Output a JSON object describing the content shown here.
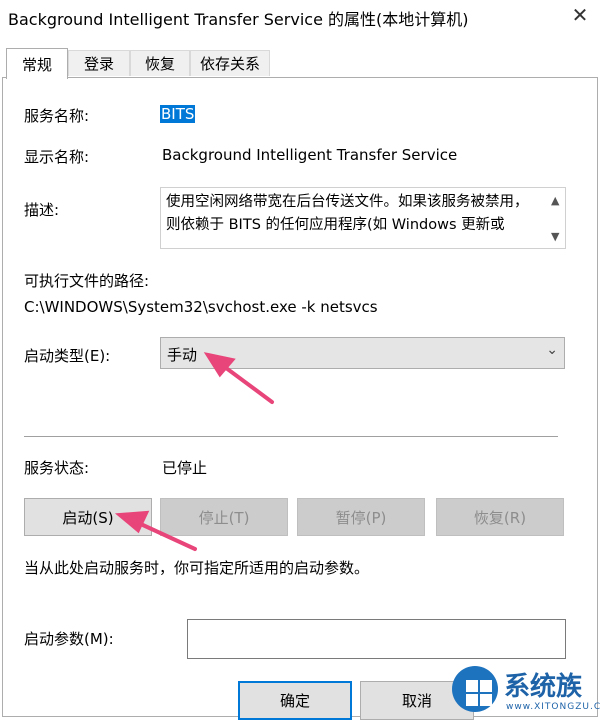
{
  "window": {
    "title": "Background Intelligent Transfer Service 的属性(本地计算机)",
    "close_glyph": "✕"
  },
  "tabs": [
    "常规",
    "登录",
    "恢复",
    "依存关系"
  ],
  "general": {
    "service_name_label": "服务名称:",
    "service_name_value": "BITS",
    "display_name_label": "显示名称:",
    "display_name_value": "Background Intelligent Transfer Service",
    "description_label": "描述:",
    "description_value": "使用空闲网络带宽在后台传送文件。如果该服务被禁用，则依赖于 BITS 的任何应用程序(如 Windows 更新或",
    "path_label": "可执行文件的路径:",
    "path_value": "C:\\WINDOWS\\System32\\svchost.exe -k netsvcs",
    "startup_type_label": "启动类型(E):",
    "startup_type_value": "手动",
    "status_label": "服务状态:",
    "status_value": "已停止",
    "buttons": {
      "start": "启动(S)",
      "stop": "停止(T)",
      "pause": "暂停(P)",
      "resume": "恢复(R)"
    },
    "hint": "当从此处启动服务时，你可指定所适用的启动参数。",
    "start_params_label": "启动参数(M):",
    "start_params_value": ""
  },
  "footer": {
    "ok": "确定",
    "cancel": "取消"
  },
  "watermark": {
    "text": "系统族",
    "sub": "www.XITONGZU.COM"
  },
  "colors": {
    "selection": "#0078d7",
    "annotation_arrow": "#e8457a",
    "watermark": "#1e63a8"
  }
}
